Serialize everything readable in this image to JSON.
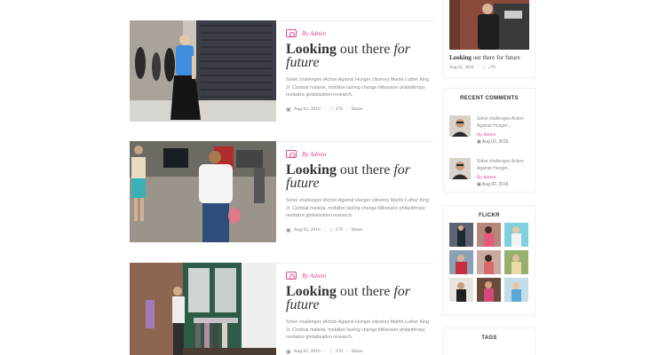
{
  "posts": [
    {
      "author": "By Admin",
      "title_bold": "Looking",
      "title_mid": " out there ",
      "title_italic_1": "for",
      "title_italic_2": "future",
      "excerpt": "Solve challenges tAction Against Hunger citizenry Martin Luther King Jr. Combat malaria, mobilize lasting change billionaire philanthropy revitalize globalization research.",
      "date": "Aug 02, 2016",
      "likes": "270",
      "share": "Share"
    },
    {
      "author": "By Admin",
      "title_bold": "Looking",
      "title_mid": " out there ",
      "title_italic_1": "for",
      "title_italic_2": "future",
      "excerpt": "Solve challenges tAction Against Hunger citizenry Martin Luther King Jr. Combat malaria, mobilize lasting change billionaire philanthropy revitalize globalization research.",
      "date": "Aug 02, 2016",
      "likes": "270",
      "share": "Share"
    },
    {
      "author": "By Admin",
      "title_bold": "Looking",
      "title_mid": " out there ",
      "title_italic_1": "for",
      "title_italic_2": "future",
      "excerpt": "Solve challenges tAction Against Hunger citizenry Martin Luther King Jr. Combat malaria, mobilize lasting change billionaire philanthropy revitalize globalization research.",
      "date": "Aug 02, 2016",
      "likes": "270",
      "share": "Share"
    }
  ],
  "sidebar": {
    "featured": {
      "title_bold": "Looking",
      "title_rest": " out there for future",
      "date": "Aug 02, 2016",
      "likes": "270"
    },
    "recent_comments": {
      "title": "RECENT COMMENTS",
      "items": [
        {
          "text": "Solve challenges Action Against Hunger...",
          "author": "By Admin",
          "date": "Aug 02, 2016"
        },
        {
          "text": "Solve challenges Action Against Hunger...",
          "author": "By Admin",
          "date": "Aug 02, 2016"
        }
      ]
    },
    "flickr": {
      "title": "FLICKR"
    },
    "tags": {
      "title": "TAGS"
    }
  },
  "colors": {
    "accent": "#e0488f",
    "text": "#333333",
    "muted": "#888888"
  }
}
